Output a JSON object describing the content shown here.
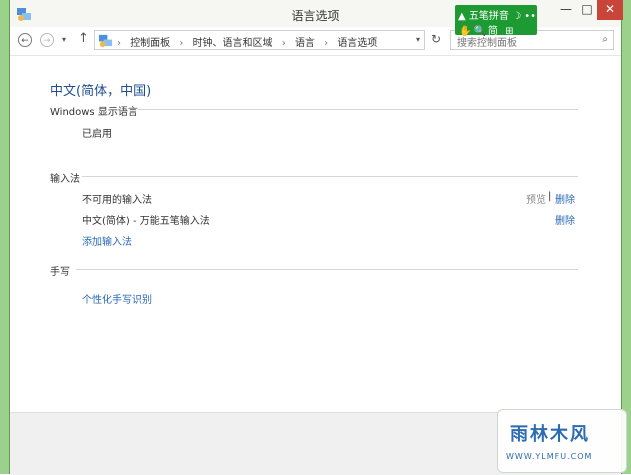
{
  "window": {
    "title": "语言选项",
    "controls": {
      "minimize": "—",
      "maximize": "□",
      "close": "✕"
    }
  },
  "ime_toolbar": {
    "name": "五笔拼音",
    "row1_extra": "☽ ••",
    "row2": "✋🔍简 ⊞"
  },
  "navigation": {
    "back": "←",
    "forward": "→",
    "dropdown": "▾",
    "up": "↑",
    "breadcrumbs": [
      "控制面板",
      "时钟、语言和区域",
      "语言",
      "语言选项"
    ],
    "separator": "›",
    "address_dropdown": "▾",
    "refresh": "↻",
    "search_placeholder": "搜索控制面板",
    "search_icon": "⌕"
  },
  "page": {
    "title": "中文(简体，中国)",
    "display_language": {
      "heading": "Windows 显示语言",
      "status": "已启用"
    },
    "input_methods": {
      "heading": "输入法",
      "rows": [
        {
          "name": "不可用的输入法",
          "preview": "预览",
          "separator": "|",
          "remove": "删除"
        },
        {
          "name": "中文(简体) - 万能五笔输入法",
          "remove": "删除"
        }
      ],
      "add_link": "添加输入法"
    },
    "handwriting": {
      "heading": "手写",
      "link": "个性化手写识别"
    }
  },
  "watermark": {
    "logo_text": "雨林木风",
    "url": "WWW.YLMFU.COM"
  },
  "colors": {
    "link": "#2a6ab6",
    "title": "#1e4f8c",
    "ime_bg": "#1d9a31",
    "close_bg": "#c9453a",
    "desktop": "#9bd18a"
  }
}
